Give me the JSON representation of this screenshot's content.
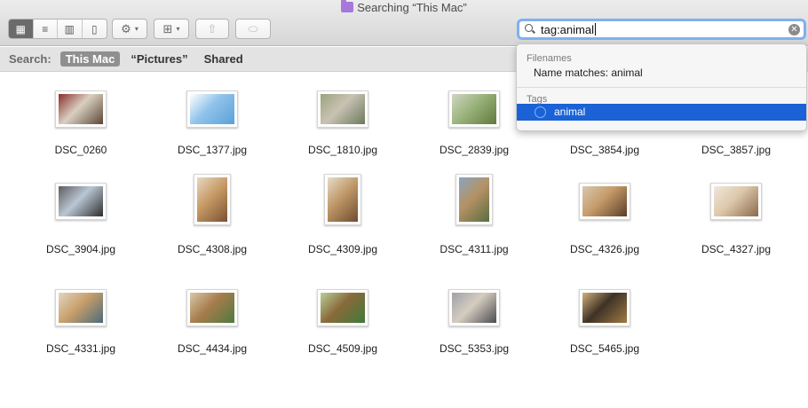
{
  "window": {
    "title": "Searching “This Mac”"
  },
  "toolbar": {
    "view_buttons": [
      {
        "icon": "icon-view-grid-icon",
        "glyph": "▦"
      },
      {
        "icon": "list-view-icon",
        "glyph": "≡"
      },
      {
        "icon": "column-view-icon",
        "glyph": "▥"
      },
      {
        "icon": "cover-flow-icon",
        "glyph": "▯"
      }
    ],
    "action_glyph": "⚙",
    "arrange_glyph": "⊞",
    "share_glyph": "⇧",
    "tag_glyph": "⬭",
    "caret_glyph": "▾"
  },
  "search": {
    "value": "tag:animal",
    "clear_glyph": "✕"
  },
  "scope": {
    "label": "Search:",
    "options": [
      "This Mac",
      "“Pictures”",
      "Shared"
    ],
    "active": "This Mac"
  },
  "dropdown": {
    "sections": [
      {
        "header": "Filenames",
        "items": [
          "Name matches: animal"
        ]
      },
      {
        "header": "Tags",
        "items": [
          "animal"
        ]
      }
    ],
    "selected": "animal"
  },
  "files": [
    {
      "name": "DSC_0260",
      "colors": [
        "#5b4634",
        "#d9d0c2",
        "#8a2f2a"
      ]
    },
    {
      "name": "DSC_1377.jpg",
      "colors": [
        "#5aa0d8",
        "#8fc3ea",
        "#ffffff"
      ]
    },
    {
      "name": "DSC_1810.jpg",
      "colors": [
        "#6b7a5c",
        "#c9c2b3",
        "#9ca37d"
      ]
    },
    {
      "name": "DSC_2839.jpg",
      "colors": [
        "#5f7a3a",
        "#9ab27c",
        "#cfd6c4"
      ]
    },
    {
      "name": "DSC_3854.jpg",
      "colors": [
        "#7a6040",
        "#c3a57c",
        "#d8cdb9"
      ]
    },
    {
      "name": "DSC_3857.jpg",
      "colors": [
        "#705a45",
        "#b89a78",
        "#e4d8c8"
      ]
    },
    {
      "name": "DSC_3904.jpg",
      "colors": [
        "#2e2e2e",
        "#b9c6d3",
        "#5d5d5d"
      ]
    },
    {
      "name": "DSC_4308.jpg",
      "colors": [
        "#7a5232",
        "#c79a66",
        "#e7d8c4"
      ]
    },
    {
      "name": "DSC_4309.jpg",
      "colors": [
        "#6f4c30",
        "#bf9868",
        "#e6dcc9"
      ]
    },
    {
      "name": "DSC_4311.jpg",
      "colors": [
        "#5b6d3f",
        "#b59266",
        "#88a4c0"
      ]
    },
    {
      "name": "DSC_4326.jpg",
      "colors": [
        "#5a3d28",
        "#c69b69",
        "#d7c7b2"
      ]
    },
    {
      "name": "DSC_4327.jpg",
      "colors": [
        "#8a6a4a",
        "#dcc7aa",
        "#efe8dc"
      ]
    },
    {
      "name": "DSC_4331.jpg",
      "colors": [
        "#4c6a7a",
        "#c89f6a",
        "#e1d6c2"
      ]
    },
    {
      "name": "DSC_4434.jpg",
      "colors": [
        "#4f7a40",
        "#a67c4c",
        "#d9c9a8"
      ]
    },
    {
      "name": "DSC_4509.jpg",
      "colors": [
        "#3f7a3a",
        "#8a6a3a",
        "#b9cf9a"
      ]
    },
    {
      "name": "DSC_5353.jpg",
      "colors": [
        "#4b4b52",
        "#d5cdbf",
        "#a0a0aa"
      ]
    },
    {
      "name": "DSC_5465.jpg",
      "colors": [
        "#a07a45",
        "#3e3226",
        "#d2b07a"
      ]
    }
  ]
}
